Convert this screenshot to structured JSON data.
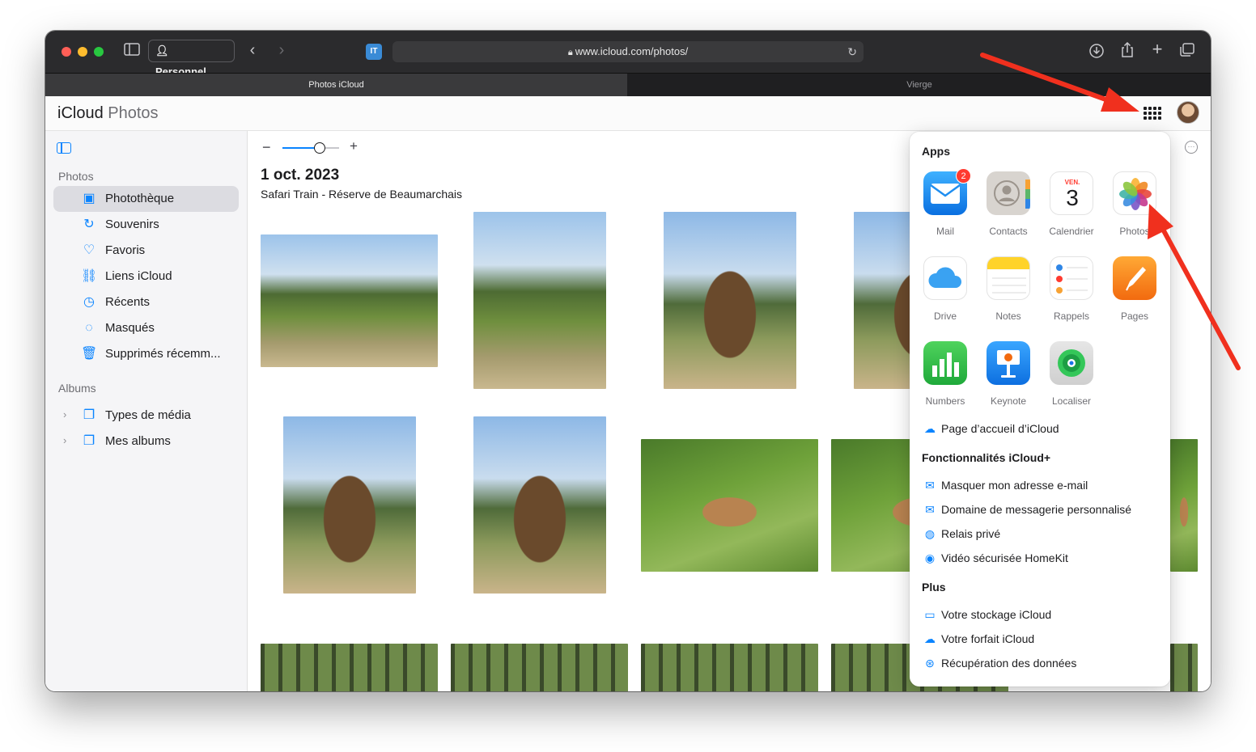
{
  "browser": {
    "profile_label": "Personnel",
    "url": "www.icloud.com/photos/",
    "extension_label": "IT",
    "tabs": [
      {
        "label": "Photos iCloud"
      },
      {
        "label": "Vierge"
      }
    ]
  },
  "header": {
    "brand": "iCloud",
    "app_name": "Photos"
  },
  "sidebar": {
    "sections": [
      {
        "title": "Photos"
      },
      {
        "title": "Albums"
      }
    ],
    "items": [
      {
        "label": "Photothèque",
        "icon": "photo-library-icon"
      },
      {
        "label": "Souvenirs",
        "icon": "memories-icon"
      },
      {
        "label": "Favoris",
        "icon": "heart-icon"
      },
      {
        "label": "Liens iCloud",
        "icon": "icloud-link-icon"
      },
      {
        "label": "Récents",
        "icon": "clock-icon"
      },
      {
        "label": "Masqués",
        "icon": "eye-slash-icon"
      },
      {
        "label": "Supprimés récemm...",
        "icon": "trash-icon"
      }
    ],
    "albums": [
      {
        "label": "Types de média",
        "icon": "media-types-icon"
      },
      {
        "label": "Mes albums",
        "icon": "albums-icon"
      }
    ]
  },
  "main": {
    "zoom_level": 0.65,
    "date_title": "1 oct. 2023",
    "location": "Safari Train - Réserve de Beaumarchais"
  },
  "menu": {
    "apps_title": "Apps",
    "apps": [
      {
        "name": "Mail",
        "badge": "2"
      },
      {
        "name": "Contacts"
      },
      {
        "name": "Calendrier",
        "cal_day": "VEN.",
        "cal_date": "3"
      },
      {
        "name": "Photos"
      },
      {
        "name": "Drive"
      },
      {
        "name": "Notes"
      },
      {
        "name": "Rappels"
      },
      {
        "name": "Pages"
      },
      {
        "name": "Numbers"
      },
      {
        "name": "Keynote"
      },
      {
        "name": "Localiser"
      }
    ],
    "home_link": "Page d’accueil d’iCloud",
    "features_title": "Fonctionnalités iCloud+",
    "features": [
      {
        "label": "Masquer mon adresse e-mail"
      },
      {
        "label": "Domaine de messagerie personnalisé"
      },
      {
        "label": "Relais privé"
      },
      {
        "label": "Vidéo sécurisée HomeKit"
      }
    ],
    "more_title": "Plus",
    "more": [
      {
        "label": "Votre stockage iCloud"
      },
      {
        "label": "Votre forfait iCloud"
      },
      {
        "label": "Récupération des données"
      }
    ]
  },
  "colors": {
    "accent": "#0a84ff",
    "annotation_arrow": "#f0301e"
  }
}
